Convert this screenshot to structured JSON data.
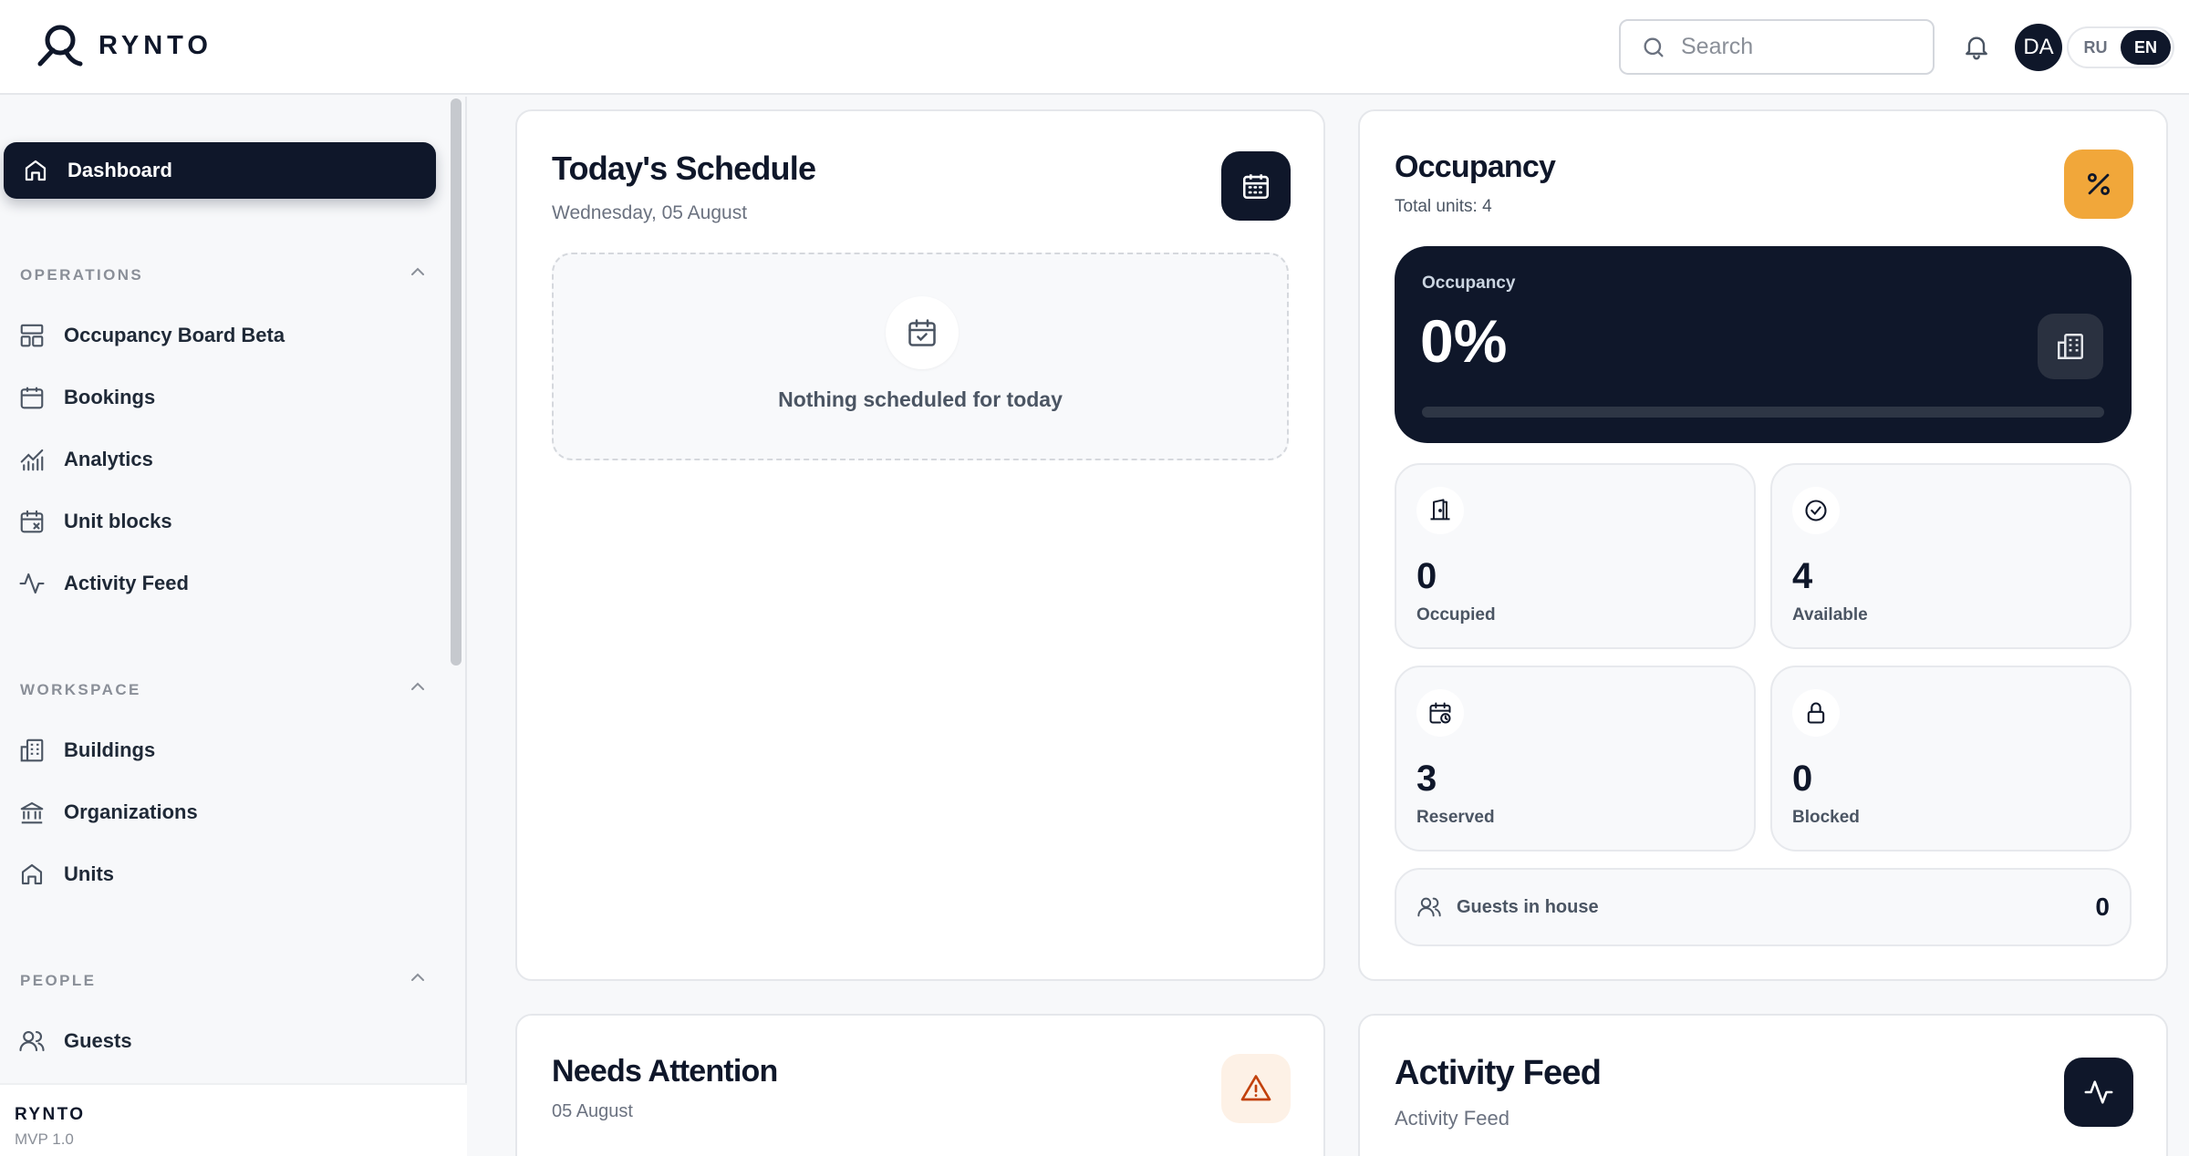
{
  "brand": {
    "name": "RYNTO"
  },
  "header": {
    "search_placeholder": "Search",
    "avatar_initials": "DA",
    "languages": [
      "RU",
      "EN"
    ],
    "active_language": "EN"
  },
  "sidebar": {
    "active_item": "Dashboard",
    "sections": [
      {
        "title": "OPERATIONS",
        "items": [
          "Occupancy Board Beta",
          "Bookings",
          "Analytics",
          "Unit blocks",
          "Activity Feed"
        ]
      },
      {
        "title": "WORKSPACE",
        "items": [
          "Buildings",
          "Organizations",
          "Units"
        ]
      },
      {
        "title": "PEOPLE",
        "items": [
          "Guests"
        ]
      }
    ],
    "footer": {
      "name": "RYNTO",
      "version": "MVP 1.0"
    }
  },
  "schedule": {
    "title": "Today's Schedule",
    "date": "Wednesday, 05 August",
    "empty_text": "Nothing scheduled for today"
  },
  "occupancy": {
    "title": "Occupancy",
    "total_units": "Total units: 4",
    "panel_label": "Occupancy",
    "percent": "0%",
    "percent_value": 0,
    "accent_color": "#f1a73a",
    "stats": [
      {
        "value": "0",
        "label": "Occupied",
        "icon": "door-icon"
      },
      {
        "value": "4",
        "label": "Available",
        "icon": "check-circle-icon"
      },
      {
        "value": "3",
        "label": "Reserved",
        "icon": "calendar-clock-icon"
      },
      {
        "value": "0",
        "label": "Blocked",
        "icon": "lock-icon"
      }
    ],
    "guests_label": "Guests in house",
    "guests_value": "0"
  },
  "attention": {
    "title": "Needs Attention",
    "date": "05 August",
    "accent_color": "#c2410c"
  },
  "activity": {
    "title": "Activity Feed",
    "subtitle": "Activity Feed"
  }
}
